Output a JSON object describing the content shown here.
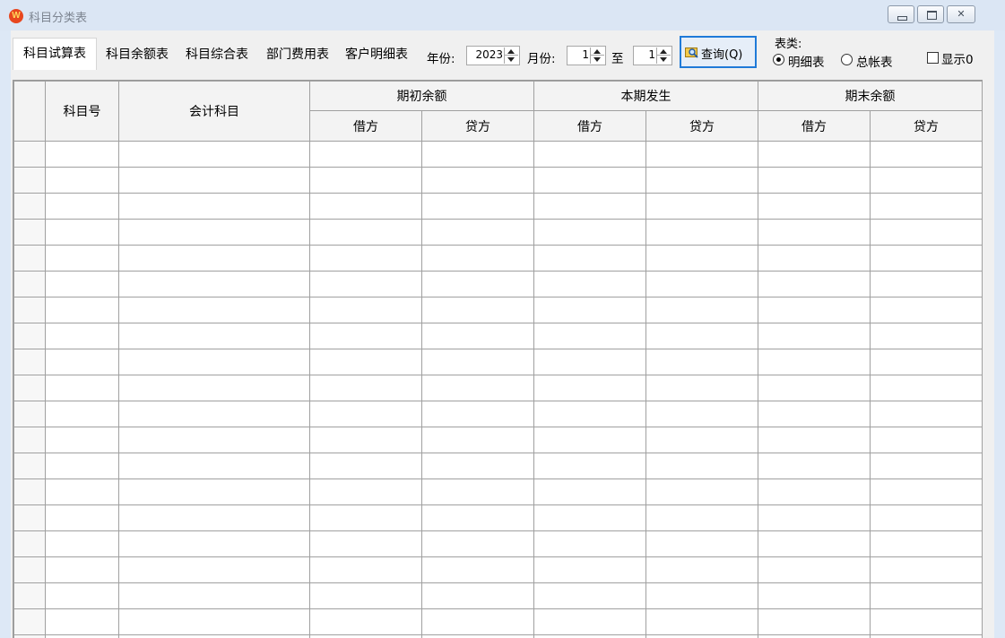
{
  "window": {
    "app_icon_letter": "W",
    "title": "科目分类表",
    "min_glyph": "—",
    "max_glyph": "▢",
    "close_glyph": "✕"
  },
  "tabs": [
    {
      "label": "科目试算表",
      "active": true
    },
    {
      "label": "科目余额表",
      "active": false
    },
    {
      "label": "科目综合表",
      "active": false
    },
    {
      "label": "部门费用表",
      "active": false
    },
    {
      "label": "客户明细表",
      "active": false
    }
  ],
  "filters": {
    "year_label": "年份:",
    "year_value": "2023",
    "month_label": "月份:",
    "month_from": "1",
    "to_label": "至",
    "month_to": "1",
    "query_label": "查询(Q)"
  },
  "table_type": {
    "label": "表类:",
    "options": [
      {
        "label": "明细表",
        "selected": true
      },
      {
        "label": "总帐表",
        "selected": false
      }
    ]
  },
  "show_zero": {
    "label": "显示0",
    "checked": false
  },
  "grid": {
    "col_account_no": "科目号",
    "col_account": "会计科目",
    "group_opening": "期初余额",
    "group_current": "本期发生",
    "group_closing": "期末余额",
    "debit": "借方",
    "credit": "贷方",
    "rows": [
      [],
      [],
      [],
      [],
      [],
      [],
      [],
      [],
      [],
      [],
      [],
      [],
      [],
      [],
      [],
      [],
      [],
      [],
      [],
      []
    ]
  },
  "colors": {
    "window_bg": "#dde8f6",
    "client_bg": "#f0f0f0",
    "accent_border": "#1f7ad8",
    "icon_red": "#e8471f"
  }
}
